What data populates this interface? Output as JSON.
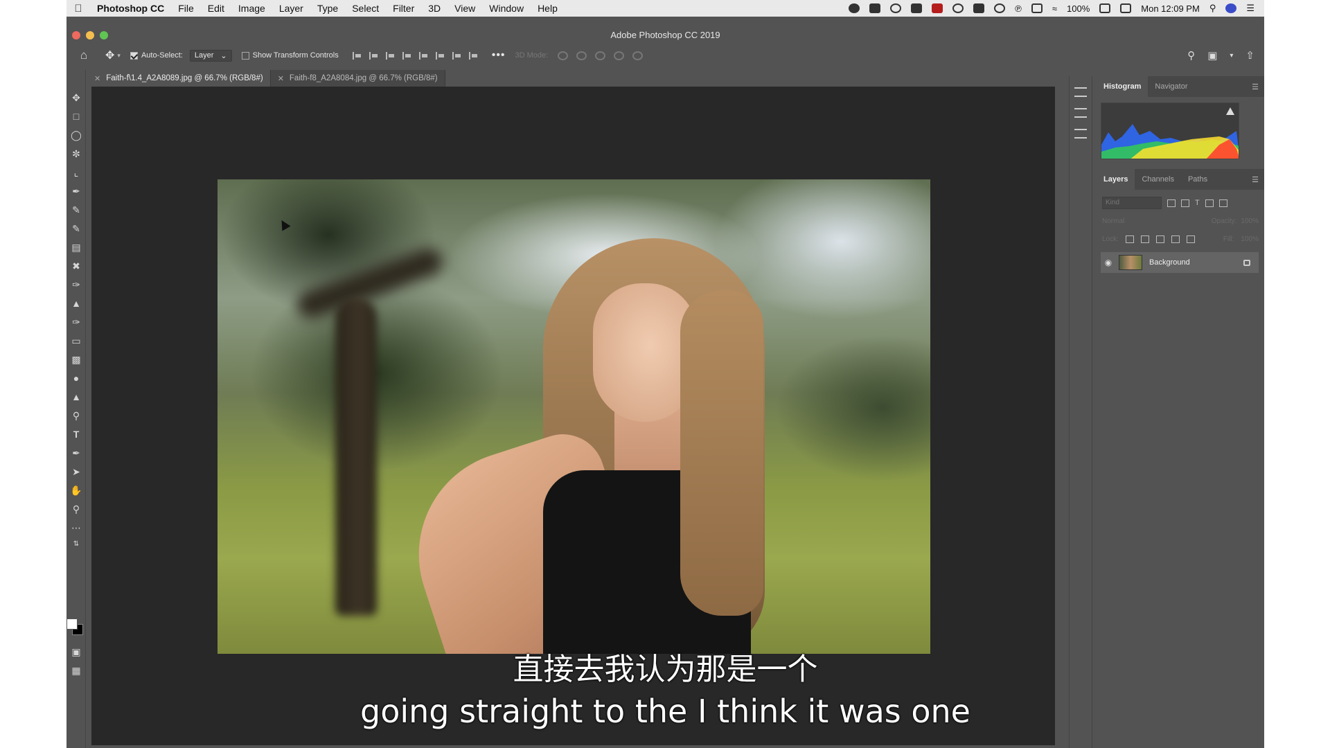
{
  "menubar": {
    "app_name": "Photoshop CC",
    "items": [
      "File",
      "Edit",
      "Image",
      "Layer",
      "Type",
      "Select",
      "Filter",
      "3D",
      "View",
      "Window",
      "Help"
    ],
    "battery": "100%",
    "clock": "Mon 12:09 PM"
  },
  "window": {
    "title": "Adobe Photoshop CC 2019"
  },
  "options": {
    "auto_select_label": "Auto-Select:",
    "auto_select_value": "Layer",
    "show_transform_label": "Show Transform Controls",
    "mode_3d_label": "3D Mode:"
  },
  "tabs": [
    {
      "label": "Faith-f\\1.4_A2A8089.jpg @ 66.7% (RGB/8#)",
      "active": true
    },
    {
      "label": "Faith-f8_A2A8084.jpg @ 66.7% (RGB/8#)",
      "active": false
    }
  ],
  "subtitles": {
    "chinese": "直接去我认为那是一个",
    "english": "going straight to the I think it was one"
  },
  "histogram_panel": {
    "tabs": [
      "Histogram",
      "Navigator"
    ]
  },
  "layers_panel": {
    "tabs": [
      "Layers",
      "Channels",
      "Paths"
    ],
    "kind_placeholder": "Kind",
    "blend_mode": "Normal",
    "opacity_label": "Opacity:",
    "opacity_value": "100%",
    "lock_label": "Lock:",
    "fill_label": "Fill:",
    "fill_value": "100%",
    "layers": [
      {
        "name": "Background",
        "visible": true,
        "locked": true
      }
    ]
  }
}
